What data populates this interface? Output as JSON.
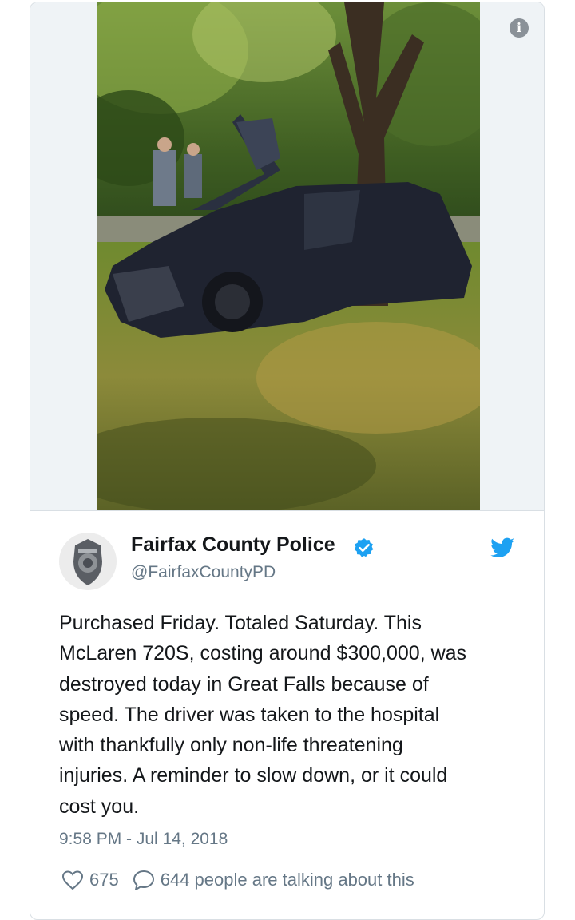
{
  "tweet": {
    "author_name": "Fairfax County Police",
    "author_handle": "@FairfaxCountyPD",
    "text_lines": [
      "Purchased Friday. Totaled Saturday. This",
      "McLaren 720S, costing around $300,000, was",
      "destroyed today in Great Falls because of",
      "speed. The driver was taken to the hospital",
      "with thankfully only non-life threatening",
      "injuries. A reminder to slow down, or it could",
      "cost you."
    ],
    "timestamp": "9:58 PM - Jul 14, 2018",
    "likes": "675",
    "talking": "644 people are talking about this"
  },
  "icons": {
    "info": "info-icon",
    "verified": "verified-badge-icon",
    "brand": "twitter-bird-icon",
    "like": "heart-icon",
    "reply": "comment-bubble-icon"
  },
  "colors": {
    "brand": "#1da1f2",
    "text": "#14171a",
    "secondary": "#657786",
    "border": "#d9dfe4",
    "media_background": "#eff3f6"
  }
}
